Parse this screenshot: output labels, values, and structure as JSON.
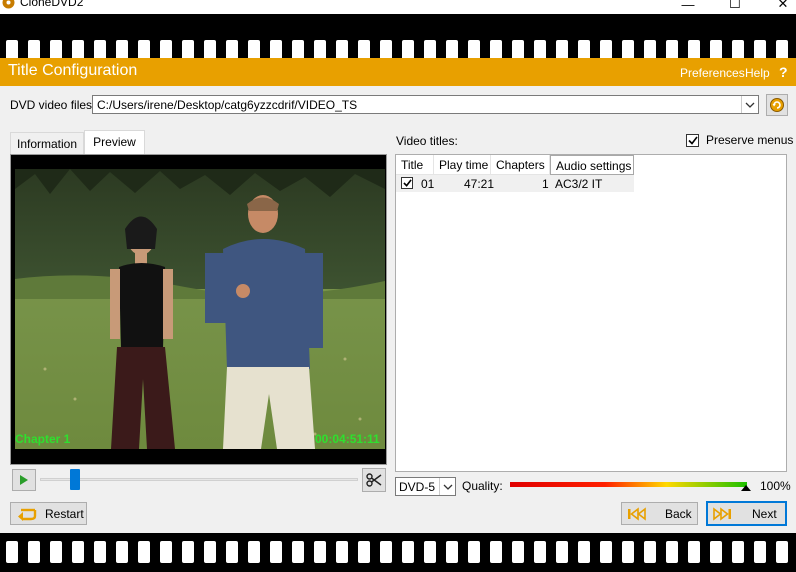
{
  "window": {
    "title": "CloneDVD2",
    "minimize": "—",
    "maximize": "☐",
    "close": "✕"
  },
  "header": {
    "title": "Title Configuration",
    "preferences": "Preferences",
    "help": "Help",
    "help_icon": "?"
  },
  "source": {
    "label": "DVD video files:",
    "path": "C:/Users/irene/Desktop/catg6yzzcdrif/VIDEO_TS"
  },
  "tabs": [
    {
      "label": "Information",
      "active": false
    },
    {
      "label": "Preview",
      "active": true
    }
  ],
  "preview": {
    "chapter_overlay": "Chapter 1",
    "timecode_overlay": "00:04:51:11",
    "position_fraction": 0.11
  },
  "titles": {
    "label": "Video titles:",
    "preserve_menus_label": "Preserve menus",
    "preserve_menus_checked": true,
    "columns": [
      "Title",
      "Play time",
      "Chapters",
      "Audio settings"
    ],
    "rows": [
      {
        "checked": true,
        "title": "01",
        "play_time": "47:21",
        "chapters": "1",
        "audio": "AC3/2 IT"
      }
    ]
  },
  "output": {
    "disc_type": "DVD-5",
    "quality_label": "Quality:",
    "quality_value": "100%"
  },
  "buttons": {
    "restart": "Restart",
    "back": "Back",
    "next": "Next"
  },
  "colors": {
    "header_bg": "#e8a000",
    "accent": "#0078d7",
    "osd_text": "#2ee02e"
  },
  "icons": {
    "app": "clonedvd-app-icon",
    "refresh": "refresh-icon",
    "play": "play-icon",
    "cut": "scissors-icon",
    "restart": "return-arrow-icon",
    "back": "skip-back-icon",
    "next": "skip-next-icon"
  }
}
